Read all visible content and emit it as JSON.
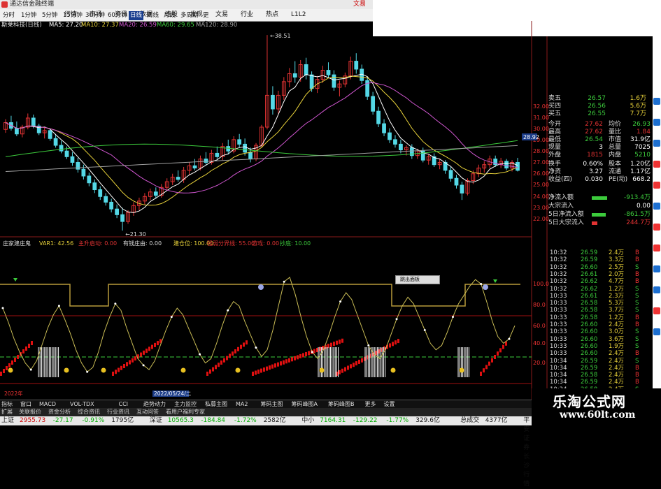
{
  "window": {
    "title": "通达信金融终端",
    "right_label": "文易"
  },
  "toolbar": {
    "menu": [
      "行情",
      "市场",
      "资讯",
      "数据",
      "选股",
      "发现",
      "文易",
      "行业",
      "热点",
      "L1L2"
    ]
  },
  "periods": {
    "items": [
      "分时",
      "1分钟",
      "5分钟",
      "15分钟",
      "30分钟",
      "60分钟",
      "日线",
      "周线",
      "月线",
      "多周期",
      "更多"
    ],
    "selected_index": 6
  },
  "stock": {
    "name": "斯莱科技(日线)",
    "ma": [
      {
        "label": "MA5: 27.20",
        "color": "#ffffff"
      },
      {
        "label": "MA10: 27.37",
        "color": "#e8d23a"
      },
      {
        "label": "MA20: 26.59",
        "color": "#d056d0"
      },
      {
        "label": "MA60: 29.65",
        "color": "#3ccb3c"
      },
      {
        "label": "MA120: 28.90",
        "color": "#a0a0a0"
      }
    ],
    "high_label": "38.51",
    "low_label": "21.30",
    "current_price_tag": "28.92"
  },
  "price_axis": [
    "32.00",
    "31.00",
    "30.00",
    "29.00",
    "28.00",
    "27.00",
    "26.00",
    "25.00",
    "24.00",
    "23.00",
    "22.00"
  ],
  "indicator_axis": [
    "100.0",
    "80.0",
    "60.0",
    "40.0",
    "20.0"
  ],
  "indicator": {
    "items": [
      {
        "label": "庄家建庄鬼",
        "color": "#dddddd"
      },
      {
        "label": "VAR1: 42.56",
        "color": "#e8d23a"
      },
      {
        "label": "主升启动: 0.00",
        "color": "#e33333"
      },
      {
        "label": "有钱庄由: 0.00",
        "color": "#dddddd"
      },
      {
        "label": "建仓位: 100.00",
        "color": "#e8d23a"
      },
      {
        "label": "强弱分界线: 55.00",
        "color": "#e33333"
      },
      {
        "label": "游戏: 0.00",
        "color": "#e33333"
      },
      {
        "label": "抄底: 10.00",
        "color": "#3ccb3c"
      }
    ],
    "popup": "跳出面板"
  },
  "bottom_dates": {
    "left": "2022年",
    "highlight": "2022/05/24/二"
  },
  "quote": [
    {
      "label": "卖五",
      "v1": "26.57",
      "v2": "1.6万",
      "c1": "#3ccb3c"
    },
    {
      "label": "买四",
      "v1": "26.56",
      "v2": "5.6万",
      "c1": "#3ccb3c"
    },
    {
      "label": "买五",
      "v1": "26.55",
      "v2": "7.7万",
      "c1": "#3ccb3c"
    }
  ],
  "stats": [
    {
      "l1": "今开",
      "v1": "27.62",
      "c1": "#e33333",
      "l2": "均价",
      "v2": "26.93",
      "c2": "#3ccb3c"
    },
    {
      "l1": "最高",
      "v1": "27.62",
      "c1": "#e33333",
      "l2": "量比",
      "v2": "1.84",
      "c2": "#e33333"
    },
    {
      "l1": "最低",
      "v1": "26.54",
      "c1": "#3ccb3c",
      "l2": "市值",
      "v2": "31.9亿",
      "c2": "#ffffff"
    },
    {
      "l1": "现量",
      "v1": "3",
      "c1": "#ffffff",
      "l2": "总量",
      "v2": "7025",
      "c2": "#ffffff"
    },
    {
      "l1": "外盘",
      "v1": "1815",
      "c1": "#e33333",
      "l2": "内盘",
      "v2": "5210",
      "c2": "#3ccb3c"
    },
    {
      "l1": "换手",
      "v1": "0.60%",
      "c1": "#ffffff",
      "l2": "股本",
      "v2": "1.20亿",
      "c2": "#ffffff"
    },
    {
      "l1": "净资",
      "v1": "3.27",
      "c1": "#ffffff",
      "l2": "流通",
      "v2": "1.17亿",
      "c2": "#ffffff"
    },
    {
      "l1": "收益(四)",
      "v1": "0.030",
      "c1": "#ffffff",
      "l2": "PE(动)",
      "v2": "668.2",
      "c2": "#ffffff"
    }
  ],
  "flows": [
    {
      "label": "净流入额",
      "value": "-913.4万",
      "color": "#3ccb3c",
      "bar": 0.55
    },
    {
      "label": "大宗流入",
      "value": "0.00",
      "color": "#ffffff",
      "bar": 0
    },
    {
      "label": "5日净流入额",
      "value": "-861.5万",
      "color": "#3ccb3c",
      "bar": 0.5
    },
    {
      "label": "5日大宗流入",
      "value": "244.7万",
      "color": "#e33333",
      "bar": 0.2
    }
  ],
  "ticks": [
    {
      "t": "10:32",
      "p": "26.59",
      "v": "2.4万",
      "s": "B"
    },
    {
      "t": "10:32",
      "p": "26.59",
      "v": "3.3万",
      "s": "B"
    },
    {
      "t": "10:32",
      "p": "26.60",
      "v": "2.5万",
      "s": "S"
    },
    {
      "t": "10:32",
      "p": "26.61",
      "v": "2.0万",
      "s": "B"
    },
    {
      "t": "10:32",
      "p": "26.62",
      "v": "4.7万",
      "s": "B"
    },
    {
      "t": "10:32",
      "p": "26.62",
      "v": "1.2万",
      "s": "S"
    },
    {
      "t": "10:33",
      "p": "26.61",
      "v": "2.3万",
      "s": "S"
    },
    {
      "t": "10:33",
      "p": "26.58",
      "v": "5.3万",
      "s": "S"
    },
    {
      "t": "10:33",
      "p": "26.58",
      "v": "3.7万",
      "s": "S"
    },
    {
      "t": "10:33",
      "p": "26.58",
      "v": "1.2万",
      "s": "B"
    },
    {
      "t": "10:33",
      "p": "26.60",
      "v": "2.4万",
      "s": "B"
    },
    {
      "t": "10:33",
      "p": "26.60",
      "v": "3.0万",
      "s": "S"
    },
    {
      "t": "10:33",
      "p": "26.60",
      "v": "3.6万",
      "s": "S"
    },
    {
      "t": "10:33",
      "p": "26.60",
      "v": "1.9万",
      "s": "S"
    },
    {
      "t": "10:33",
      "p": "26.60",
      "v": "2.4万",
      "s": "B"
    },
    {
      "t": "10:34",
      "p": "26.59",
      "v": "2.4万",
      "s": "S"
    },
    {
      "t": "10:34",
      "p": "26.59",
      "v": "2.4万",
      "s": "B"
    },
    {
      "t": "10:34",
      "p": "26.58",
      "v": "2.4万",
      "s": "B"
    },
    {
      "t": "10:34",
      "p": "26.59",
      "v": "2.4万",
      "s": "B"
    },
    {
      "t": "10:34",
      "p": "26.58",
      "v": "2.4万",
      "s": "S"
    }
  ],
  "tabs": [
    "指标",
    "窗口",
    "MACD",
    "VOL-TDX",
    "CCI",
    "趋势动力",
    "主力监控",
    "私募主图",
    "MA2",
    "筹码主图",
    "筹码峰图A",
    "筹码峰图B",
    "更多",
    "设置"
  ],
  "tabs2": [
    "扩展",
    "关联报价",
    "资金分析",
    "综合资讯",
    "行业资讯",
    "互动问答",
    "看用户福利专家"
  ],
  "status": [
    {
      "text": "上证",
      "color": "#111"
    },
    {
      "text": "2955.73",
      "color": "#c00"
    },
    {
      "text": "-27.17",
      "color": "#0a0"
    },
    {
      "text": "-0.91%",
      "color": "#0a0"
    },
    {
      "text": "1795亿",
      "color": "#111"
    },
    {
      "text": "深证",
      "color": "#111"
    },
    {
      "text": "10565.3",
      "color": "#0a0"
    },
    {
      "text": "-184.84",
      "color": "#0a0"
    },
    {
      "text": "-1.72%",
      "color": "#0a0"
    },
    {
      "text": "2582亿",
      "color": "#111"
    },
    {
      "text": "中小",
      "color": "#111"
    },
    {
      "text": "7164.31",
      "color": "#0a0"
    },
    {
      "text": "-129.22",
      "color": "#0a0"
    },
    {
      "text": "-1.77%",
      "color": "#0a0"
    },
    {
      "text": "329.6亿",
      "color": "#111"
    },
    {
      "text": "总成交",
      "color": "#111"
    },
    {
      "text": "4377亿",
      "color": "#111"
    },
    {
      "text": "平安证券长沙行情",
      "color": "#111"
    }
  ],
  "watermark": {
    "title": "乐淘公式网",
    "url": "www.60lt.com"
  },
  "series": {
    "candles": [
      [
        30.2,
        31.1,
        29.9,
        30.8
      ],
      [
        30.8,
        31.4,
        30.1,
        30.3
      ],
      [
        30.3,
        30.9,
        29.6,
        29.8
      ],
      [
        29.8,
        30.6,
        29.5,
        30.4
      ],
      [
        30.4,
        31.6,
        30.2,
        31.2
      ],
      [
        31.2,
        31.5,
        30.3,
        30.5
      ],
      [
        30.5,
        30.7,
        29.7,
        29.9
      ],
      [
        29.9,
        30.4,
        29.4,
        30.1
      ],
      [
        30.1,
        30.2,
        29.2,
        29.4
      ],
      [
        29.4,
        29.8,
        28.6,
        28.8
      ],
      [
        28.8,
        29.2,
        28.1,
        28.3
      ],
      [
        28.3,
        28.7,
        27.6,
        27.8
      ],
      [
        27.8,
        28.2,
        27.0,
        27.3
      ],
      [
        27.3,
        27.7,
        26.4,
        26.7
      ],
      [
        26.7,
        27.1,
        25.8,
        26.1
      ],
      [
        26.1,
        26.4,
        25.2,
        25.5
      ],
      [
        25.5,
        25.8,
        24.6,
        24.9
      ],
      [
        24.9,
        25.2,
        24.0,
        24.3
      ],
      [
        24.3,
        24.6,
        23.5,
        23.8
      ],
      [
        23.8,
        24.1,
        22.9,
        23.2
      ],
      [
        23.2,
        23.6,
        22.4,
        22.7
      ],
      [
        22.7,
        23.3,
        21.3,
        22.1
      ],
      [
        22.1,
        23.1,
        21.9,
        22.9
      ],
      [
        22.9,
        23.8,
        22.6,
        23.5
      ],
      [
        23.5,
        24.2,
        23.1,
        23.9
      ],
      [
        23.9,
        24.6,
        23.6,
        24.3
      ],
      [
        24.3,
        25.0,
        24.0,
        24.7
      ],
      [
        24.7,
        25.1,
        24.1,
        24.4
      ],
      [
        24.4,
        25.4,
        24.2,
        25.1
      ],
      [
        25.1,
        25.9,
        24.9,
        25.6
      ],
      [
        25.6,
        26.3,
        25.3,
        26.0
      ],
      [
        26.0,
        26.6,
        25.6,
        25.8
      ],
      [
        25.8,
        26.9,
        25.5,
        26.6
      ],
      [
        26.6,
        27.3,
        26.2,
        27.0
      ],
      [
        27.0,
        27.6,
        26.6,
        26.8
      ],
      [
        26.8,
        27.9,
        26.6,
        27.6
      ],
      [
        27.6,
        28.2,
        27.1,
        27.3
      ],
      [
        27.3,
        28.4,
        27.1,
        28.1
      ],
      [
        28.1,
        28.7,
        27.6,
        27.8
      ],
      [
        27.8,
        29.0,
        27.5,
        28.7
      ],
      [
        28.7,
        29.3,
        28.0,
        28.3
      ],
      [
        28.3,
        29.6,
        28.1,
        29.3
      ],
      [
        29.3,
        29.8,
        28.6,
        28.9
      ],
      [
        28.9,
        29.4,
        27.9,
        28.2
      ],
      [
        28.2,
        28.6,
        27.3,
        27.6
      ],
      [
        27.6,
        29.0,
        27.4,
        28.8
      ],
      [
        28.8,
        30.6,
        28.6,
        30.4
      ],
      [
        30.4,
        38.5,
        30.2,
        33.2
      ],
      [
        33.2,
        34.0,
        31.5,
        32.0
      ],
      [
        32.0,
        33.6,
        31.6,
        33.2
      ],
      [
        33.2,
        34.8,
        32.8,
        34.4
      ],
      [
        34.4,
        35.6,
        33.9,
        35.1
      ],
      [
        35.1,
        36.2,
        34.3,
        34.8
      ],
      [
        34.8,
        36.3,
        34.4,
        35.9
      ],
      [
        35.9,
        36.5,
        34.6,
        35.0
      ],
      [
        35.0,
        35.3,
        33.5,
        33.8
      ],
      [
        33.8,
        34.9,
        33.4,
        34.6
      ],
      [
        34.6,
        35.8,
        34.3,
        35.4
      ],
      [
        35.4,
        36.1,
        34.7,
        35.0
      ],
      [
        35.0,
        35.4,
        33.6,
        33.9
      ],
      [
        33.9,
        34.5,
        33.1,
        34.2
      ],
      [
        34.2,
        35.2,
        33.9,
        34.9
      ],
      [
        34.9,
        36.6,
        34.6,
        36.2
      ],
      [
        36.2,
        36.9,
        35.1,
        35.5
      ],
      [
        35.5,
        35.9,
        34.2,
        34.5
      ],
      [
        34.5,
        34.8,
        32.8,
        33.1
      ],
      [
        33.1,
        33.5,
        31.5,
        31.8
      ],
      [
        31.8,
        32.2,
        30.4,
        30.7
      ],
      [
        30.7,
        31.1,
        29.6,
        29.9
      ],
      [
        29.9,
        30.3,
        29.0,
        29.3
      ],
      [
        29.3,
        29.7,
        28.6,
        28.9
      ],
      [
        28.9,
        29.3,
        28.1,
        28.4
      ],
      [
        28.4,
        28.8,
        27.9,
        28.6
      ],
      [
        28.6,
        28.9,
        27.6,
        27.9
      ],
      [
        27.9,
        28.5,
        27.6,
        28.3
      ],
      [
        28.3,
        28.6,
        27.3,
        27.5
      ],
      [
        27.5,
        28.0,
        27.1,
        27.8
      ],
      [
        27.8,
        28.1,
        26.9,
        27.1
      ],
      [
        27.1,
        27.6,
        26.7,
        27.3
      ],
      [
        27.3,
        27.5,
        26.3,
        26.6
      ],
      [
        26.6,
        26.9,
        25.6,
        25.9
      ],
      [
        25.9,
        26.2,
        25.0,
        25.3
      ],
      [
        25.3,
        25.6,
        24.0,
        24.6
      ],
      [
        24.6,
        25.9,
        24.4,
        25.7
      ],
      [
        25.7,
        26.6,
        25.4,
        26.3
      ],
      [
        26.3,
        27.1,
        26.0,
        26.8
      ],
      [
        26.8,
        27.4,
        26.4,
        27.1
      ],
      [
        27.1,
        27.9,
        26.8,
        27.6
      ],
      [
        27.6,
        27.9,
        26.9,
        27.1
      ],
      [
        27.1,
        27.7,
        26.8,
        27.4
      ],
      [
        27.4,
        27.6,
        26.6,
        26.8
      ],
      [
        26.8,
        27.5,
        26.5,
        27.3
      ],
      [
        27.3,
        27.7,
        26.5,
        26.6
      ]
    ],
    "osc": [
      68,
      55,
      40,
      28,
      18,
      12,
      20,
      35,
      50,
      62,
      70,
      58,
      45,
      30,
      18,
      10,
      14,
      28,
      46,
      60,
      72,
      66,
      50,
      36,
      22,
      16,
      12,
      20,
      34,
      48,
      60,
      68,
      62,
      50,
      38,
      26,
      18,
      22,
      36,
      52,
      66,
      74,
      70,
      56,
      44,
      32,
      24,
      30,
      48,
      70,
      92,
      96,
      80,
      60,
      42,
      28,
      22,
      30,
      44,
      60,
      74,
      82,
      76,
      62,
      48,
      34,
      26,
      22,
      30,
      44,
      58,
      70,
      78,
      72,
      60,
      48,
      36,
      30,
      34,
      46,
      60,
      72,
      80,
      88,
      94,
      90,
      74,
      56,
      42,
      36,
      40,
      52
    ]
  }
}
